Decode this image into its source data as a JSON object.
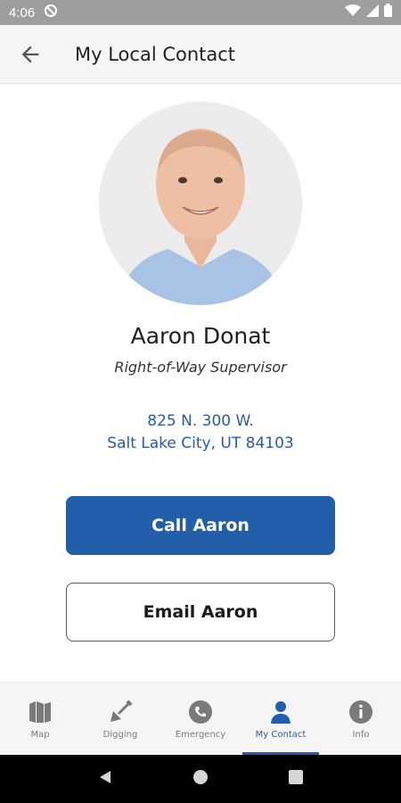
{
  "status_bar": {
    "time": "4:06"
  },
  "app_bar": {
    "title": "My Local Contact"
  },
  "contact": {
    "name": "Aaron Donat",
    "role": "Right-of-Way Supervisor",
    "address_line1": "825 N. 300 W.",
    "address_line2": "Salt Lake City, UT 84103"
  },
  "actions": {
    "call_label": "Call Aaron",
    "email_label": "Email Aaron"
  },
  "bottom_nav": [
    {
      "label": "Map",
      "icon": "map-icon",
      "active": false
    },
    {
      "label": "Digging",
      "icon": "shovel-icon",
      "active": false
    },
    {
      "label": "Emergency",
      "icon": "phone-icon",
      "active": false
    },
    {
      "label": "My Contact",
      "icon": "person-icon",
      "active": true
    },
    {
      "label": "Info",
      "icon": "info-icon",
      "active": false
    }
  ],
  "colors": {
    "accent": "#235eaa",
    "address": "#2a5ba8",
    "status_bar": "#9e9e9e",
    "inactive": "#7a7a7a"
  }
}
